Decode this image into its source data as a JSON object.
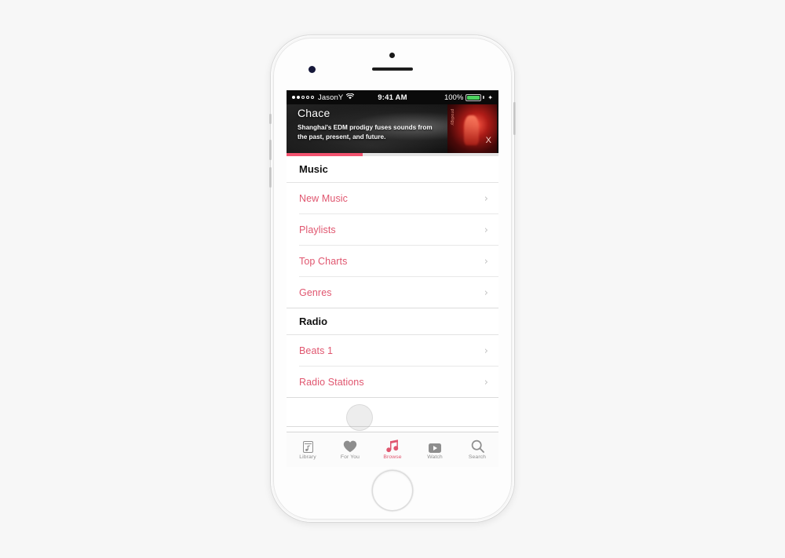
{
  "status_bar": {
    "signal_dots_total": 5,
    "signal_dots_filled": 2,
    "carrier": "JasonY",
    "wifi_icon": "wifi-icon",
    "time": "9:41 AM",
    "battery_percent": "100%",
    "battery_level": 100,
    "charging_icon": "charging-bolt-icon",
    "battery_color": "#4cd25f"
  },
  "hero": {
    "title": "Chace",
    "subtitle": "Shanghai's EDM prodigy fuses sounds from the past, present, and future.",
    "artwork_side_text": "prodigy",
    "artwork_mark": "X",
    "progress_percent": 36,
    "progress_color": "#f3536f"
  },
  "sections": [
    {
      "header": "Music",
      "items": [
        {
          "label": "New Music",
          "chevron": "chevron-right-icon"
        },
        {
          "label": "Playlists",
          "chevron": "chevron-right-icon"
        },
        {
          "label": "Top Charts",
          "chevron": "chevron-right-icon"
        },
        {
          "label": "Genres",
          "chevron": "chevron-right-icon"
        }
      ]
    },
    {
      "header": "Radio",
      "items": [
        {
          "label": "Beats 1",
          "chevron": "chevron-right-icon"
        },
        {
          "label": "Radio Stations",
          "chevron": "chevron-right-icon"
        }
      ]
    }
  ],
  "tab_bar": {
    "active_index": 2,
    "active_color": "#e0566f",
    "inactive_color": "#8e8e8e",
    "tabs": [
      {
        "label": "Library",
        "icon": "library-icon"
      },
      {
        "label": "For You",
        "icon": "heart-icon"
      },
      {
        "label": "Browse",
        "icon": "music-note-icon"
      },
      {
        "label": "Watch",
        "icon": "video-play-icon"
      },
      {
        "label": "Search",
        "icon": "search-icon"
      }
    ]
  },
  "touch_indicator": {
    "name": "tap-indicator",
    "target": "Radio Stations"
  },
  "accent_color": "#e0566f",
  "page_background": "#f7f7f7"
}
